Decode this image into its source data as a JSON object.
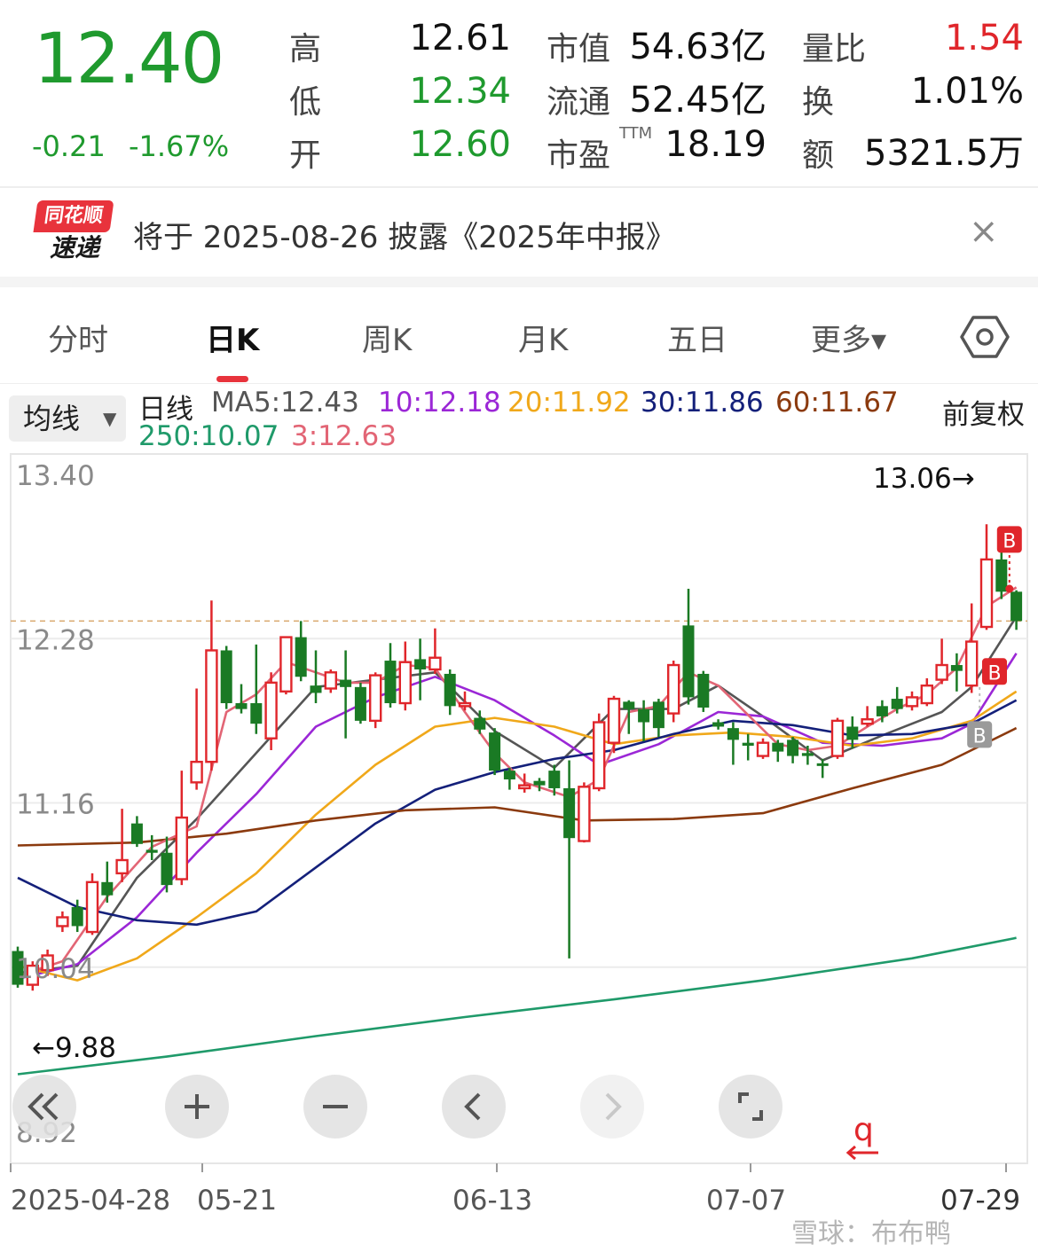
{
  "quote": {
    "price": "12.40",
    "change": "-0.21",
    "change_pct": "-1.67%",
    "high_label": "高",
    "high": "12.61",
    "low_label": "低",
    "low": "12.34",
    "open_label": "开",
    "open": "12.60",
    "mktcap_label": "市值",
    "mktcap": "54.63亿",
    "float_label": "流通",
    "float_cap": "52.45亿",
    "pe_label": "市盈",
    "pe_sup": "TTM",
    "pe": "18.19",
    "vol_ratio_label": "量比",
    "vol_ratio": "1.54",
    "turnover_label": "换",
    "turnover": "1.01%",
    "amount_label": "额",
    "amount": "5321.5万"
  },
  "notice": {
    "logo_top": "同花顺",
    "logo_bottom": "速递",
    "text": "将于 2025-08-26 披露《2025年中报》",
    "close": "×"
  },
  "tabs": [
    {
      "label": "分时",
      "active": false
    },
    {
      "label": "日K",
      "active": true
    },
    {
      "label": "周K",
      "active": false
    },
    {
      "label": "月K",
      "active": false
    },
    {
      "label": "五日",
      "active": false
    },
    {
      "label": "更多▾",
      "active": false
    }
  ],
  "legend": {
    "select": "均线",
    "caret": "▼",
    "period": "日线",
    "ma5": "MA5:12.43",
    "ma10": "10:12.18",
    "ma20": "20:11.92",
    "ma30": "30:11.86",
    "ma60": "60:11.67",
    "ma250": "250:10.07",
    "ma3": "3:12.63",
    "adjust": "前复权"
  },
  "colors": {
    "up": "#e0262b",
    "down": "#1a7a24",
    "ma5": "#555555",
    "ma10": "#9b27d6",
    "ma20": "#f0a81a",
    "ma30": "#14207a",
    "ma60": "#8b3a0e",
    "ma250": "#1f9a6a",
    "ma3": "#e26575"
  },
  "chart_data": {
    "type": "candlestick",
    "ylim": [
      8.92,
      13.4
    ],
    "y_ticks": [
      "13.40",
      "12.28",
      "11.16",
      "10.04",
      "8.92"
    ],
    "x_labels": [
      "2025-04-28",
      "05-21",
      "06-13",
      "07-07",
      "07-29"
    ],
    "max_annotation": "13.06→",
    "min_annotation": "←9.88",
    "current_price": 12.4,
    "markers": [
      "B",
      "B",
      "B"
    ],
    "candles": [
      {
        "o": 10.15,
        "c": 9.92,
        "h": 10.18,
        "l": 9.9
      },
      {
        "o": 9.92,
        "c": 10.05,
        "h": 10.08,
        "l": 9.88
      },
      {
        "o": 10.02,
        "c": 10.12,
        "h": 10.16,
        "l": 9.98
      },
      {
        "o": 10.32,
        "c": 10.38,
        "h": 10.42,
        "l": 10.28
      },
      {
        "o": 10.45,
        "c": 10.32,
        "h": 10.5,
        "l": 10.28
      },
      {
        "o": 10.28,
        "c": 10.62,
        "h": 10.68,
        "l": 10.26
      },
      {
        "o": 10.62,
        "c": 10.53,
        "h": 10.76,
        "l": 10.48
      },
      {
        "o": 10.68,
        "c": 10.77,
        "h": 11.12,
        "l": 10.62
      },
      {
        "o": 11.02,
        "c": 10.88,
        "h": 11.07,
        "l": 10.86
      },
      {
        "o": 10.84,
        "c": 10.82,
        "h": 10.94,
        "l": 10.77
      },
      {
        "o": 10.82,
        "c": 10.6,
        "h": 10.93,
        "l": 10.55
      },
      {
        "o": 10.64,
        "c": 11.06,
        "h": 11.38,
        "l": 10.6
      },
      {
        "o": 11.3,
        "c": 11.44,
        "h": 11.94,
        "l": 11.25
      },
      {
        "o": 11.44,
        "c": 12.2,
        "h": 12.54,
        "l": 11.38
      },
      {
        "o": 12.2,
        "c": 11.84,
        "h": 12.23,
        "l": 11.8
      },
      {
        "o": 11.84,
        "c": 11.8,
        "h": 11.97,
        "l": 11.77
      },
      {
        "o": 11.84,
        "c": 11.7,
        "h": 12.24,
        "l": 11.63
      },
      {
        "o": 11.6,
        "c": 11.98,
        "h": 12.05,
        "l": 11.52
      },
      {
        "o": 11.92,
        "c": 12.29,
        "h": 12.29,
        "l": 11.9
      },
      {
        "o": 12.29,
        "c": 12.02,
        "h": 12.4,
        "l": 11.99
      },
      {
        "o": 11.96,
        "c": 11.91,
        "h": 12.2,
        "l": 11.84
      },
      {
        "o": 11.94,
        "c": 12.05,
        "h": 12.07,
        "l": 11.91
      },
      {
        "o": 12.0,
        "c": 11.95,
        "h": 12.2,
        "l": 11.6
      },
      {
        "o": 11.95,
        "c": 11.72,
        "h": 11.98,
        "l": 11.7
      },
      {
        "o": 11.72,
        "c": 12.03,
        "h": 12.05,
        "l": 11.67
      },
      {
        "o": 12.13,
        "c": 11.84,
        "h": 12.25,
        "l": 11.81
      },
      {
        "o": 11.84,
        "c": 12.12,
        "h": 12.26,
        "l": 11.79
      },
      {
        "o": 12.14,
        "c": 12.07,
        "h": 12.28,
        "l": 11.86
      },
      {
        "o": 12.07,
        "c": 12.15,
        "h": 12.35,
        "l": 12.04
      },
      {
        "o": 12.04,
        "c": 11.82,
        "h": 12.07,
        "l": 11.76
      },
      {
        "o": 11.82,
        "c": 11.84,
        "h": 11.92,
        "l": 11.79
      },
      {
        "o": 11.74,
        "c": 11.66,
        "h": 11.79,
        "l": 11.63
      },
      {
        "o": 11.64,
        "c": 11.38,
        "h": 11.67,
        "l": 11.35
      },
      {
        "o": 11.38,
        "c": 11.32,
        "h": 11.4,
        "l": 11.25
      },
      {
        "o": 11.26,
        "c": 11.28,
        "h": 11.36,
        "l": 11.23
      },
      {
        "o": 11.31,
        "c": 11.28,
        "h": 11.33,
        "l": 11.24
      },
      {
        "o": 11.38,
        "c": 11.26,
        "h": 11.42,
        "l": 11.21
      },
      {
        "o": 11.26,
        "c": 10.92,
        "h": 11.45,
        "l": 10.1
      },
      {
        "o": 10.9,
        "c": 11.27,
        "h": 11.3,
        "l": 10.89
      },
      {
        "o": 11.26,
        "c": 11.71,
        "h": 11.77,
        "l": 11.24
      },
      {
        "o": 11.57,
        "c": 11.87,
        "h": 11.89,
        "l": 11.5
      },
      {
        "o": 11.85,
        "c": 11.8,
        "h": 11.86,
        "l": 11.63
      },
      {
        "o": 11.8,
        "c": 11.71,
        "h": 11.86,
        "l": 11.58
      },
      {
        "o": 11.85,
        "c": 11.67,
        "h": 11.87,
        "l": 11.61
      },
      {
        "o": 11.77,
        "c": 12.1,
        "h": 12.13,
        "l": 11.71
      },
      {
        "o": 12.37,
        "c": 11.88,
        "h": 12.62,
        "l": 11.83
      },
      {
        "o": 12.04,
        "c": 11.81,
        "h": 12.06,
        "l": 11.78
      },
      {
        "o": 11.71,
        "c": 11.68,
        "h": 11.73,
        "l": 11.66
      },
      {
        "o": 11.67,
        "c": 11.59,
        "h": 11.71,
        "l": 11.42
      },
      {
        "o": 11.57,
        "c": 11.55,
        "h": 11.63,
        "l": 11.45
      },
      {
        "o": 11.48,
        "c": 11.57,
        "h": 11.6,
        "l": 11.46
      },
      {
        "o": 11.57,
        "c": 11.51,
        "h": 11.59,
        "l": 11.44
      },
      {
        "o": 11.59,
        "c": 11.48,
        "h": 11.61,
        "l": 11.43
      },
      {
        "o": 11.5,
        "c": 11.48,
        "h": 11.55,
        "l": 11.42
      },
      {
        "o": 11.43,
        "c": 11.42,
        "h": 11.46,
        "l": 11.33
      },
      {
        "o": 11.48,
        "c": 11.72,
        "h": 11.74,
        "l": 11.46
      },
      {
        "o": 11.68,
        "c": 11.59,
        "h": 11.75,
        "l": 11.53
      },
      {
        "o": 11.7,
        "c": 11.73,
        "h": 11.82,
        "l": 11.68
      },
      {
        "o": 11.82,
        "c": 11.75,
        "h": 11.86,
        "l": 11.71
      },
      {
        "o": 11.87,
        "c": 11.8,
        "h": 11.95,
        "l": 11.77
      },
      {
        "o": 11.82,
        "c": 11.88,
        "h": 11.92,
        "l": 11.79
      },
      {
        "o": 11.84,
        "c": 11.96,
        "h": 12.01,
        "l": 11.82
      },
      {
        "o": 12.0,
        "c": 12.1,
        "h": 12.28,
        "l": 11.97
      },
      {
        "o": 12.1,
        "c": 12.06,
        "h": 12.18,
        "l": 11.92
      },
      {
        "o": 11.96,
        "c": 12.26,
        "h": 12.52,
        "l": 11.91
      },
      {
        "o": 12.36,
        "c": 12.82,
        "h": 13.06,
        "l": 12.34
      },
      {
        "o": 12.82,
        "c": 12.6,
        "h": 12.93,
        "l": 12.55
      },
      {
        "o": 12.6,
        "c": 12.4,
        "h": 12.61,
        "l": 12.34
      }
    ],
    "series": [
      {
        "name": "MA5",
        "color_key": "ma5",
        "pts": [
          [
            0,
            10.0
          ],
          [
            4,
            10.05
          ],
          [
            8,
            10.65
          ],
          [
            12,
            11.05
          ],
          [
            16,
            11.5
          ],
          [
            20,
            11.95
          ],
          [
            24,
            12.0
          ],
          [
            28,
            12.05
          ],
          [
            32,
            11.65
          ],
          [
            36,
            11.4
          ],
          [
            40,
            11.8
          ],
          [
            44,
            11.8
          ],
          [
            47,
            11.96
          ],
          [
            50,
            11.75
          ],
          [
            54,
            11.45
          ],
          [
            58,
            11.62
          ],
          [
            62,
            11.78
          ],
          [
            64,
            11.95
          ],
          [
            67,
            12.43
          ]
        ]
      },
      {
        "name": "MA10",
        "color_key": "ma10",
        "pts": [
          [
            0,
            9.96
          ],
          [
            4,
            10.06
          ],
          [
            8,
            10.38
          ],
          [
            12,
            10.82
          ],
          [
            16,
            11.22
          ],
          [
            20,
            11.68
          ],
          [
            24,
            11.88
          ],
          [
            28,
            12.02
          ],
          [
            32,
            11.86
          ],
          [
            36,
            11.62
          ],
          [
            39,
            11.42
          ],
          [
            43,
            11.56
          ],
          [
            47,
            11.78
          ],
          [
            50,
            11.75
          ],
          [
            54,
            11.57
          ],
          [
            58,
            11.55
          ],
          [
            62,
            11.6
          ],
          [
            64,
            11.7
          ],
          [
            67,
            12.18
          ]
        ]
      },
      {
        "name": "MA20",
        "color_key": "ma20",
        "pts": [
          [
            0,
            10.05
          ],
          [
            4,
            9.95
          ],
          [
            8,
            10.1
          ],
          [
            12,
            10.38
          ],
          [
            16,
            10.68
          ],
          [
            20,
            11.08
          ],
          [
            24,
            11.42
          ],
          [
            28,
            11.68
          ],
          [
            32,
            11.74
          ],
          [
            36,
            11.68
          ],
          [
            40,
            11.56
          ],
          [
            44,
            11.62
          ],
          [
            48,
            11.64
          ],
          [
            52,
            11.61
          ],
          [
            56,
            11.55
          ],
          [
            60,
            11.6
          ],
          [
            64,
            11.72
          ],
          [
            67,
            11.92
          ]
        ]
      },
      {
        "name": "MA30",
        "color_key": "ma30",
        "pts": [
          [
            0,
            10.65
          ],
          [
            4,
            10.45
          ],
          [
            8,
            10.36
          ],
          [
            12,
            10.33
          ],
          [
            16,
            10.42
          ],
          [
            20,
            10.72
          ],
          [
            24,
            11.02
          ],
          [
            28,
            11.25
          ],
          [
            32,
            11.37
          ],
          [
            36,
            11.46
          ],
          [
            40,
            11.52
          ],
          [
            44,
            11.63
          ],
          [
            48,
            11.72
          ],
          [
            52,
            11.69
          ],
          [
            56,
            11.62
          ],
          [
            60,
            11.63
          ],
          [
            64,
            11.7
          ],
          [
            67,
            11.86
          ]
        ]
      },
      {
        "name": "MA60",
        "color_key": "ma60",
        "pts": [
          [
            0,
            10.87
          ],
          [
            8,
            10.89
          ],
          [
            14,
            10.95
          ],
          [
            20,
            11.04
          ],
          [
            26,
            11.11
          ],
          [
            32,
            11.13
          ],
          [
            38,
            11.04
          ],
          [
            44,
            11.05
          ],
          [
            50,
            11.09
          ],
          [
            56,
            11.26
          ],
          [
            62,
            11.42
          ],
          [
            67,
            11.67
          ]
        ]
      },
      {
        "name": "MA250",
        "color_key": "ma250",
        "pts": [
          [
            0,
            9.31
          ],
          [
            10,
            9.43
          ],
          [
            20,
            9.57
          ],
          [
            30,
            9.7
          ],
          [
            40,
            9.82
          ],
          [
            50,
            9.95
          ],
          [
            60,
            10.1
          ],
          [
            67,
            10.24
          ]
        ]
      },
      {
        "name": "MA3",
        "color_key": "ma3",
        "pts": [
          [
            0,
            9.98
          ],
          [
            3,
            10.08
          ],
          [
            6,
            10.52
          ],
          [
            9,
            10.86
          ],
          [
            12,
            11.0
          ],
          [
            14,
            11.78
          ],
          [
            16,
            11.9
          ],
          [
            18,
            12.12
          ],
          [
            20,
            12.05
          ],
          [
            22,
            11.98
          ],
          [
            24,
            11.98
          ],
          [
            26,
            12.1
          ],
          [
            28,
            12.08
          ],
          [
            30,
            11.78
          ],
          [
            32,
            11.5
          ],
          [
            34,
            11.3
          ],
          [
            37,
            11.2
          ],
          [
            39,
            11.32
          ],
          [
            41,
            11.78
          ],
          [
            43,
            11.82
          ],
          [
            45,
            12.05
          ],
          [
            47,
            11.96
          ],
          [
            49,
            11.76
          ],
          [
            51,
            11.56
          ],
          [
            53,
            11.52
          ],
          [
            55,
            11.55
          ],
          [
            57,
            11.68
          ],
          [
            59,
            11.8
          ],
          [
            61,
            11.9
          ],
          [
            63,
            12.08
          ],
          [
            65,
            12.5
          ],
          [
            67,
            12.63
          ]
        ]
      }
    ]
  },
  "controls": [
    "rewind-all",
    "zoom-in",
    "zoom-out",
    "prev",
    "next",
    "fullscreen"
  ],
  "watermark": "雪球：布布鸭"
}
